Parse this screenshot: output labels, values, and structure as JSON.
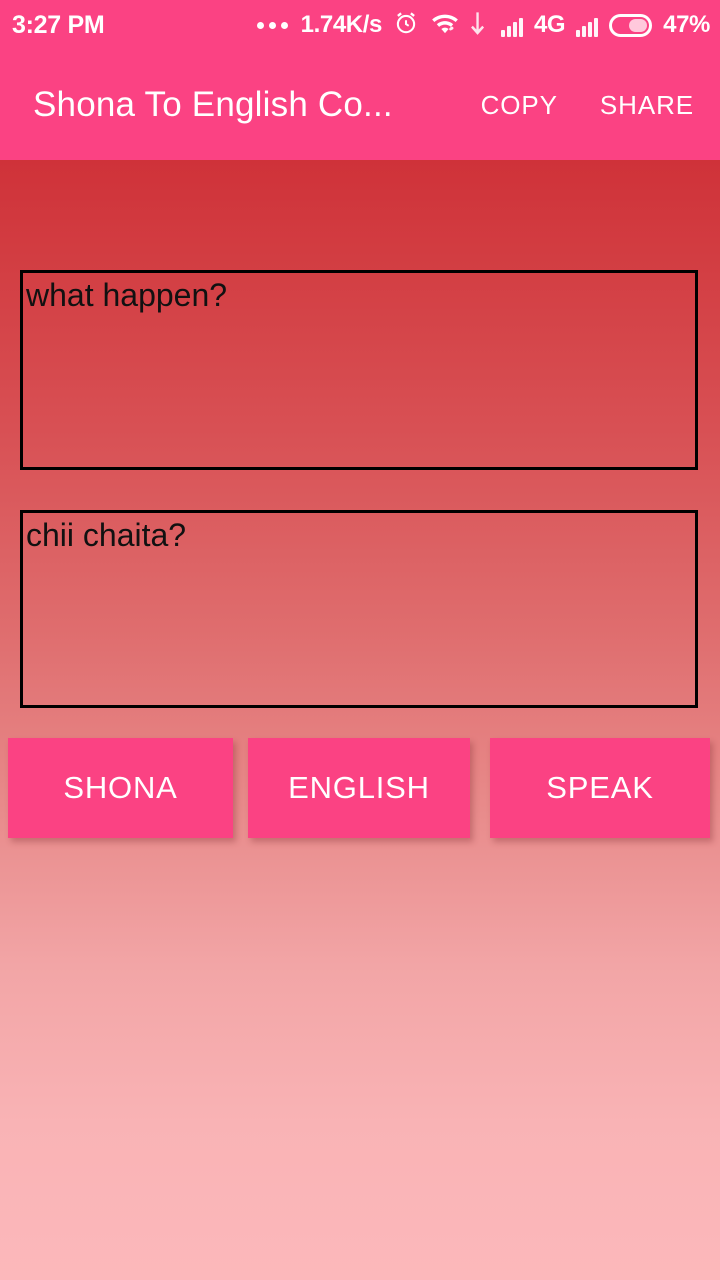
{
  "status_bar": {
    "time": "3:27 PM",
    "overflow_dots": "...",
    "network_speed": "1.74K/s",
    "alarm_icon": "alarm-clock-icon",
    "wifi_icon": "wifi-icon",
    "data_transfer_icon": "data-transfer-icon",
    "signal_icon_1": "cellular-signal-icon",
    "network_type": "4G",
    "signal_icon_2": "cellular-signal-icon",
    "battery_icon": "battery-icon",
    "battery_percent": "47%",
    "background_color": "#fb4283",
    "foreground_color": "#ffffff"
  },
  "app_bar": {
    "title": "Shona To English Co...",
    "copy_label": "COPY",
    "share_label": "SHARE",
    "background_color": "#fb4283"
  },
  "content": {
    "gradient_top_color": "#cf3239",
    "gradient_bottom_color": "#fcb8bb",
    "input": {
      "value": "what happen?",
      "placeholder": ""
    },
    "output": {
      "value": "chii chaita?",
      "placeholder": ""
    },
    "buttons": [
      {
        "label": "SHONA",
        "color": "#fb4283"
      },
      {
        "label": "ENGLISH",
        "color": "#fb4283"
      },
      {
        "label": "SPEAK",
        "color": "#fb4283"
      }
    ]
  }
}
